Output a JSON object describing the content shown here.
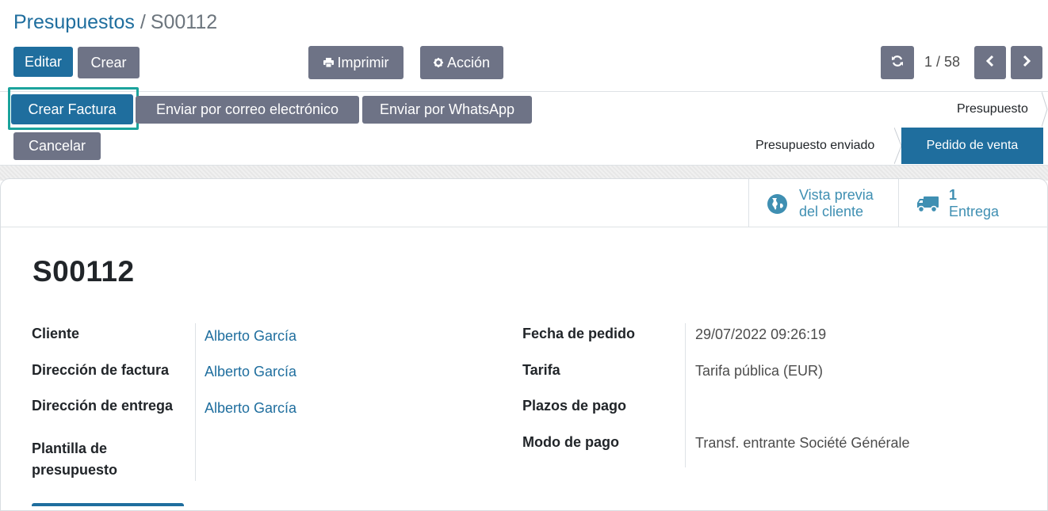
{
  "breadcrumb": {
    "parent": "Presupuestos",
    "separator": "/",
    "current": "S00112"
  },
  "toolbar": {
    "edit_label": "Editar",
    "create_label": "Crear",
    "print_label": "Imprimir",
    "action_label": "Acción"
  },
  "pager": {
    "value": "1 / 58"
  },
  "actions": {
    "create_invoice": "Crear Factura",
    "send_email": "Enviar por correo electrónico",
    "send_whatsapp": "Enviar por WhatsApp",
    "cancel": "Cancelar"
  },
  "status": {
    "stages": [
      "Presupuesto",
      "Presupuesto enviado",
      "Pedido de venta"
    ],
    "active": "Pedido de venta"
  },
  "smart_buttons": {
    "preview": {
      "line1": "Vista previa",
      "line2": "del cliente"
    },
    "delivery": {
      "count": "1",
      "label": "Entrega"
    }
  },
  "record": {
    "title": "S00112"
  },
  "fields_left": {
    "customer": {
      "label": "Cliente",
      "value": "Alberto García"
    },
    "invoice_address": {
      "label": "Dirección de factura",
      "value": "Alberto García"
    },
    "delivery_address": {
      "label": "Dirección de entrega",
      "value": "Alberto García"
    },
    "quote_template": {
      "label": "Plantilla de presupuesto",
      "value": ""
    }
  },
  "fields_right": {
    "order_date": {
      "label": "Fecha de pedido",
      "value": "29/07/2022 09:26:19"
    },
    "pricelist": {
      "label": "Tarifa",
      "value": "Tarifa pública (EUR)"
    },
    "payment_terms": {
      "label": "Plazos de pago",
      "value": ""
    },
    "payment_mode": {
      "label": "Modo de pago",
      "value": "Transf. entrante Société Générale"
    }
  },
  "colors": {
    "primary": "#1f6e9e",
    "secondary": "#6e7386",
    "highlight": "#1ba39c",
    "link": "#1f6e9e"
  }
}
